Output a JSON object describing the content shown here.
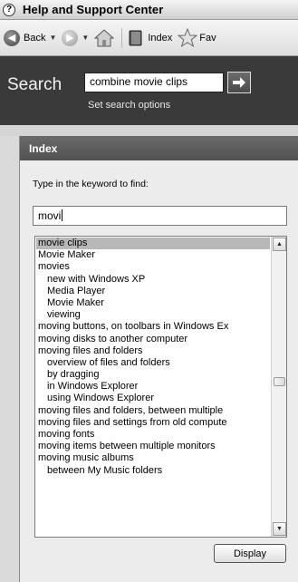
{
  "window": {
    "title": "Help and Support Center"
  },
  "toolbar": {
    "back_label": "Back",
    "index_label": "Index",
    "favorites_label": "Fav"
  },
  "search": {
    "label": "Search",
    "value": "combine movie clips",
    "options_link": "Set search options"
  },
  "index_panel": {
    "title": "Index",
    "prompt": "Type in the keyword to find:",
    "keyword_value": "movi",
    "items": [
      {
        "text": "movie clips",
        "indent": false,
        "selected": true
      },
      {
        "text": "Movie Maker",
        "indent": false,
        "selected": false
      },
      {
        "text": "movies",
        "indent": false,
        "selected": false
      },
      {
        "text": "new with Windows XP",
        "indent": true,
        "selected": false
      },
      {
        "text": "Media Player",
        "indent": true,
        "selected": false
      },
      {
        "text": "Movie Maker",
        "indent": true,
        "selected": false
      },
      {
        "text": "viewing",
        "indent": true,
        "selected": false
      },
      {
        "text": "moving buttons, on toolbars in Windows Ex",
        "indent": false,
        "selected": false
      },
      {
        "text": "moving disks to another computer",
        "indent": false,
        "selected": false
      },
      {
        "text": "moving files and folders",
        "indent": false,
        "selected": false
      },
      {
        "text": "overview of files and folders",
        "indent": true,
        "selected": false
      },
      {
        "text": "by dragging",
        "indent": true,
        "selected": false
      },
      {
        "text": "in Windows Explorer",
        "indent": true,
        "selected": false
      },
      {
        "text": "using Windows Explorer",
        "indent": true,
        "selected": false
      },
      {
        "text": "moving files and folders, between multiple",
        "indent": false,
        "selected": false
      },
      {
        "text": "moving files and settings from old compute",
        "indent": false,
        "selected": false
      },
      {
        "text": "moving fonts",
        "indent": false,
        "selected": false
      },
      {
        "text": "moving items between multiple monitors",
        "indent": false,
        "selected": false
      },
      {
        "text": "moving music albums",
        "indent": false,
        "selected": false
      },
      {
        "text": "between My Music folders",
        "indent": true,
        "selected": false
      }
    ],
    "display_button": "Display"
  }
}
